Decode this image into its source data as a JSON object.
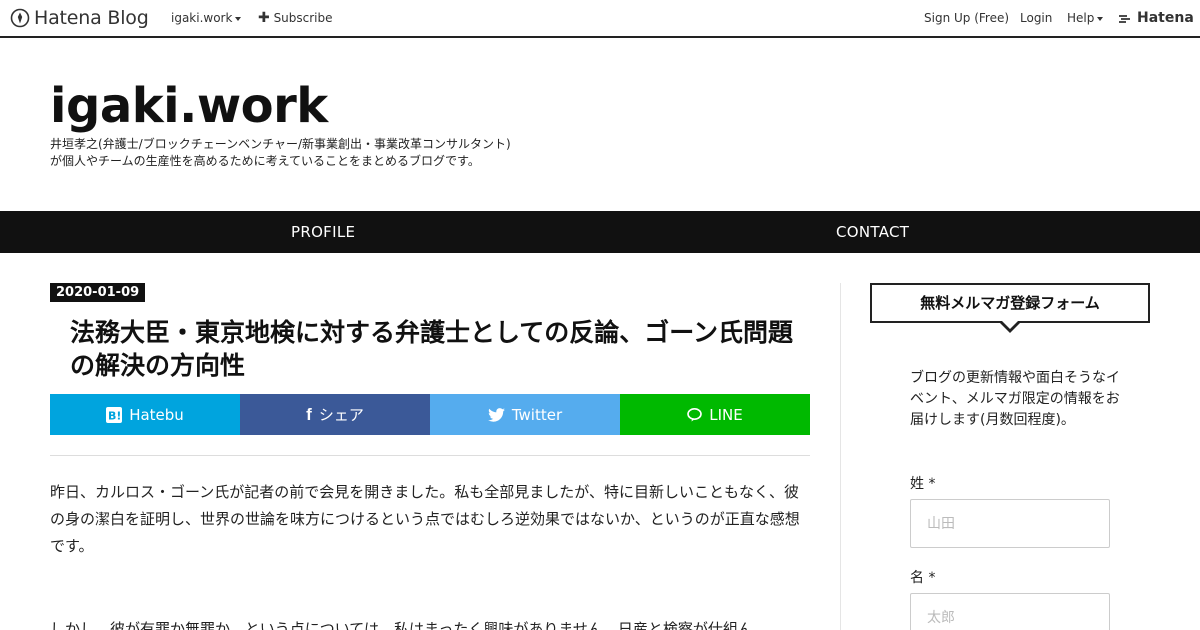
{
  "topbar": {
    "logo_text": "Hatena Blog",
    "blog_menu": "igaki.work",
    "subscribe": "Subscribe",
    "signup": "Sign Up (Free)",
    "login": "Login",
    "help": "Help",
    "hatena": "Hatena"
  },
  "header": {
    "title": "igaki.work",
    "desc_line1": "井垣孝之(弁護士/ブロックチェーンベンチャー/新事業創出・事業改革コンサルタント)",
    "desc_line2": "が個人やチームの生産性を高めるために考えていることをまとめるブログです。"
  },
  "nav": {
    "profile": "PROFILE",
    "contact": "CONTACT"
  },
  "article": {
    "date": "2020-01-09",
    "title": "法務大臣・東京地検に対する弁護士としての反論、ゴーン氏問題の解決の方向性",
    "share": {
      "hatebu": "Hatebu",
      "facebook": "シェア",
      "twitter": "Twitter",
      "line": "LINE"
    },
    "paragraph1": "昨日、カルロス・ゴーン氏が記者の前で会見を開きました。私も全部見ましたが、特に目新しいこともなく、彼の身の潔白を証明し、世界の世論を味方につけるという点ではむしろ逆効果ではないか、というのが正直な感想です。",
    "paragraph2": "しかし、彼が有罪か無罪か、という点については、私はまったく興味がありません。日産と検察が仕組ん"
  },
  "sidebar": {
    "box_title": "無料メルマガ登録フォーム",
    "description": "ブログの更新情報や面白そうなイベント、メルマガ限定の情報をお届けします(月数回程度)。",
    "last_name_label": "姓 *",
    "last_name_placeholder": "山田",
    "first_name_label": "名 *",
    "first_name_placeholder": "太郎"
  },
  "colors": {
    "hatebu": "#00a4de",
    "facebook": "#3b5998",
    "twitter": "#55acee",
    "line": "#00b900",
    "nav_bg": "#111111"
  }
}
